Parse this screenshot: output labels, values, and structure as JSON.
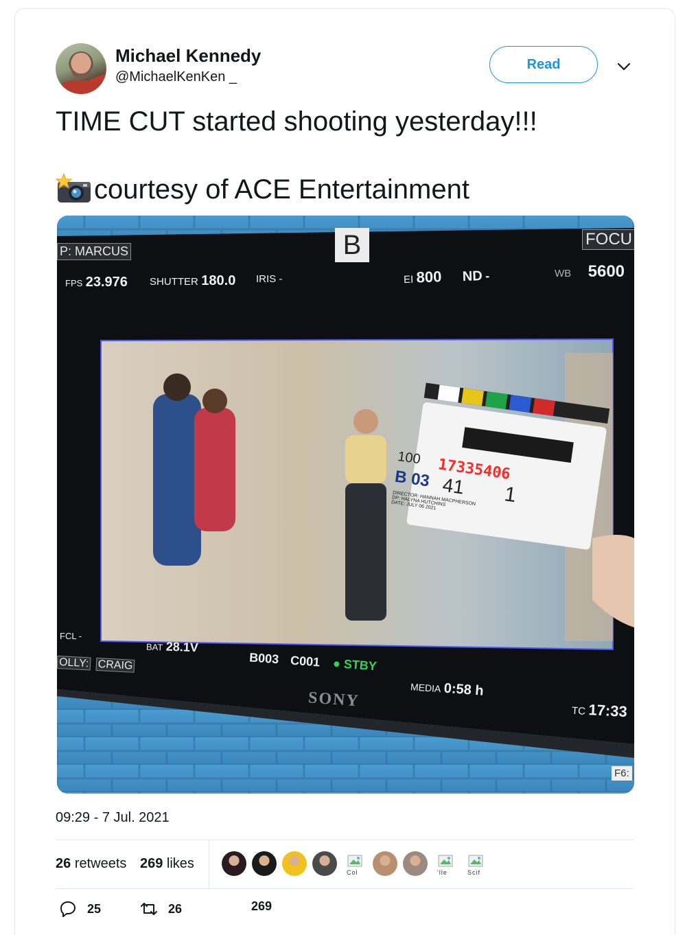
{
  "author": {
    "name": "Michael Kennedy",
    "handle": "@MichaelKenKen _"
  },
  "follow_button": {
    "label": "Read"
  },
  "tweet": {
    "line1": "TIME CUT started shooting yesterday!!!",
    "line2": "courtesy of ACE Entertainment",
    "emoji_icon": "camera-with-flash-icon"
  },
  "media_overlay": {
    "top_left_tag": "P: MARCUS",
    "camera_letter": "B",
    "top_right_tag": "FOCU",
    "fps_label": "FPS",
    "fps_value": "23.976",
    "shutter_label": "SHUTTER",
    "shutter_value": "180.0",
    "iris_label": "IRIS",
    "iris_value": "-",
    "ei_label": "EI",
    "ei_value": "800",
    "nd_label": "ND",
    "nd_value": "-",
    "wb_label": "WB",
    "wb_value": "5600",
    "fcl_label": "FCL",
    "fcl_value": "-",
    "bat_label": "BAT",
    "bat_value": "28.1V",
    "dolly_tag": "OLLY:",
    "dolly_name": "CRAIG",
    "reel": "B003",
    "clip": "C001",
    "status": "STBY",
    "media_label": "MEDIA",
    "media_value": "0:58 h",
    "tc_label": "TC",
    "tc_value": "17:33",
    "brand": "SONY",
    "model": "F6:",
    "slate_lens": "100",
    "slate_roll": "B 03",
    "slate_scene": "41",
    "slate_take": "1",
    "slate_timecode": "17335406",
    "slate_director": "DIRECTOR: HANNAH MACPHERSON",
    "slate_dp": "DP: HALYNA HUTCHINS",
    "slate_date": "DATE: JULY 06 2021"
  },
  "timestamp": "09:29 - 7 Jul. 2021",
  "stats": {
    "retweets_count": "26",
    "retweets_label": "retweets",
    "likes_count": "269",
    "likes_label": "likes"
  },
  "liker_avatars": [
    {
      "kind": "photo",
      "color": "#2a1a24"
    },
    {
      "kind": "photo",
      "color": "#1a1a1a"
    },
    {
      "kind": "photo",
      "color": "#f2c21c"
    },
    {
      "kind": "photo",
      "color": "#4a4a4a"
    },
    {
      "kind": "broken",
      "alt": "Col"
    },
    {
      "kind": "photo",
      "color": "#b89070"
    },
    {
      "kind": "photo",
      "color": "#9a8a80"
    },
    {
      "kind": "broken",
      "alt": "'lle"
    },
    {
      "kind": "broken",
      "alt": "Scif"
    }
  ],
  "actions": {
    "reply_count": "25",
    "retweet_count": "26",
    "like_count": "269"
  },
  "colors": {
    "accent": "#1b95e0",
    "text": "#14171a",
    "border": "#e1e8ed"
  }
}
